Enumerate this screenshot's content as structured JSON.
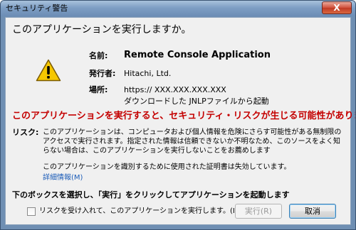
{
  "window": {
    "title": "セキュリティ警告",
    "close_symbol": "X"
  },
  "heading": "このアプリケーションを実行しますか。",
  "icon": "warning-icon",
  "info": {
    "name_label": "名前:",
    "name_value": "Remote Console Application",
    "publisher_label": "発行者:",
    "publisher_value": "Hitachi, Ltd.",
    "location_label": "場所:",
    "location_value": "https:// XXX.XXX.XXX.XXX",
    "location_note": "ダウンロードした JNLPファイルから起動"
  },
  "risk": {
    "heading": "このアプリケーションを実行すると、セキュリティ・リスクが生じる可能性があります",
    "label": "リスク:",
    "text": "このアプリケーションは、コンピュータおよび個人情報を危険にさらす可能性がある無制限のアクセスで実行されます。指定された情報は信頼できないか不明なため、このソースをよく知らない場合は、このアプリケーションを実行しないことをお薦めします",
    "cert_text": "このアプリケーションを識別するために使用された証明書は失効しています。",
    "details_link": "詳細情報(M)"
  },
  "instruction": "下のボックスを選択し、「実行」をクリックしてアプリケーションを起動します",
  "accept_checkbox": {
    "label": "リスクを受け入れて、このアプリケーションを実行します。(I)",
    "checked": false
  },
  "buttons": {
    "run": "実行(R)",
    "cancel": "取消"
  },
  "colors": {
    "risk_heading": "#c40000",
    "link": "#1b5cb8",
    "warning_fill": "#f6c700"
  }
}
